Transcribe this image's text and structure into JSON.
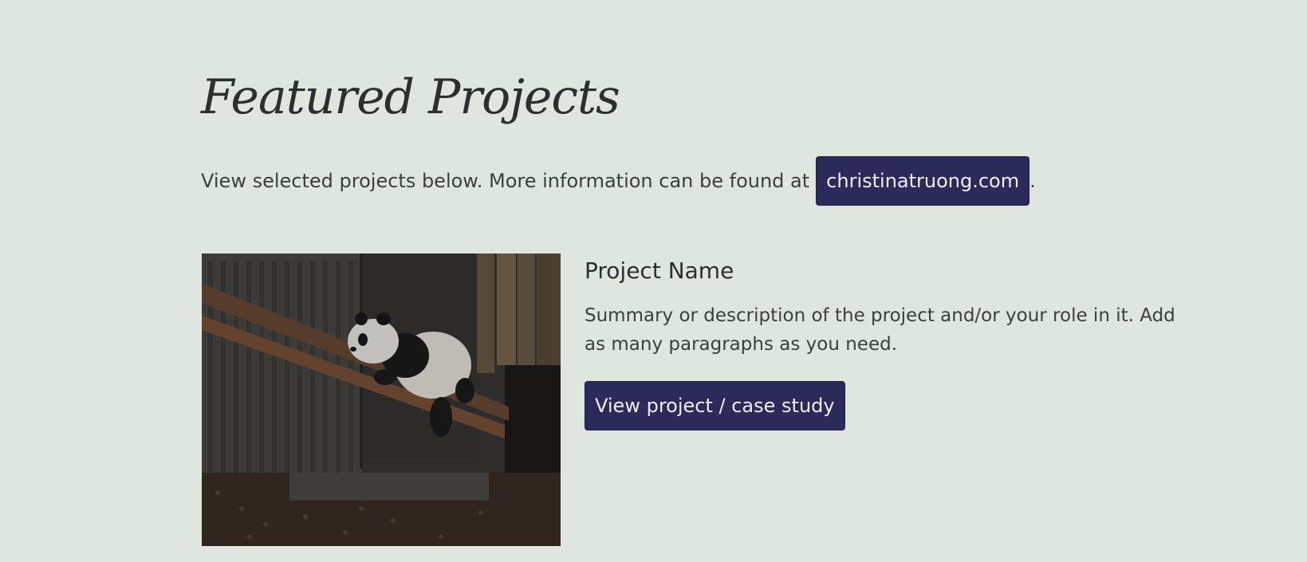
{
  "section": {
    "title": "Featured Projects",
    "intro_text": "View selected projects below. More information can be found at",
    "link_label": "christinatruong.com",
    "intro_suffix": "."
  },
  "project": {
    "name": "Project Name",
    "summary": "Summary or description of the project and/or your role in it. Add as many paragraphs as you need.",
    "button_label": "View project / case study",
    "image": "panda-on-wooden-logs-photo"
  },
  "colors": {
    "background": "#dfe6df",
    "button": "#2c2a5a",
    "button_text": "#eeeef6",
    "text": "#2f3331"
  }
}
